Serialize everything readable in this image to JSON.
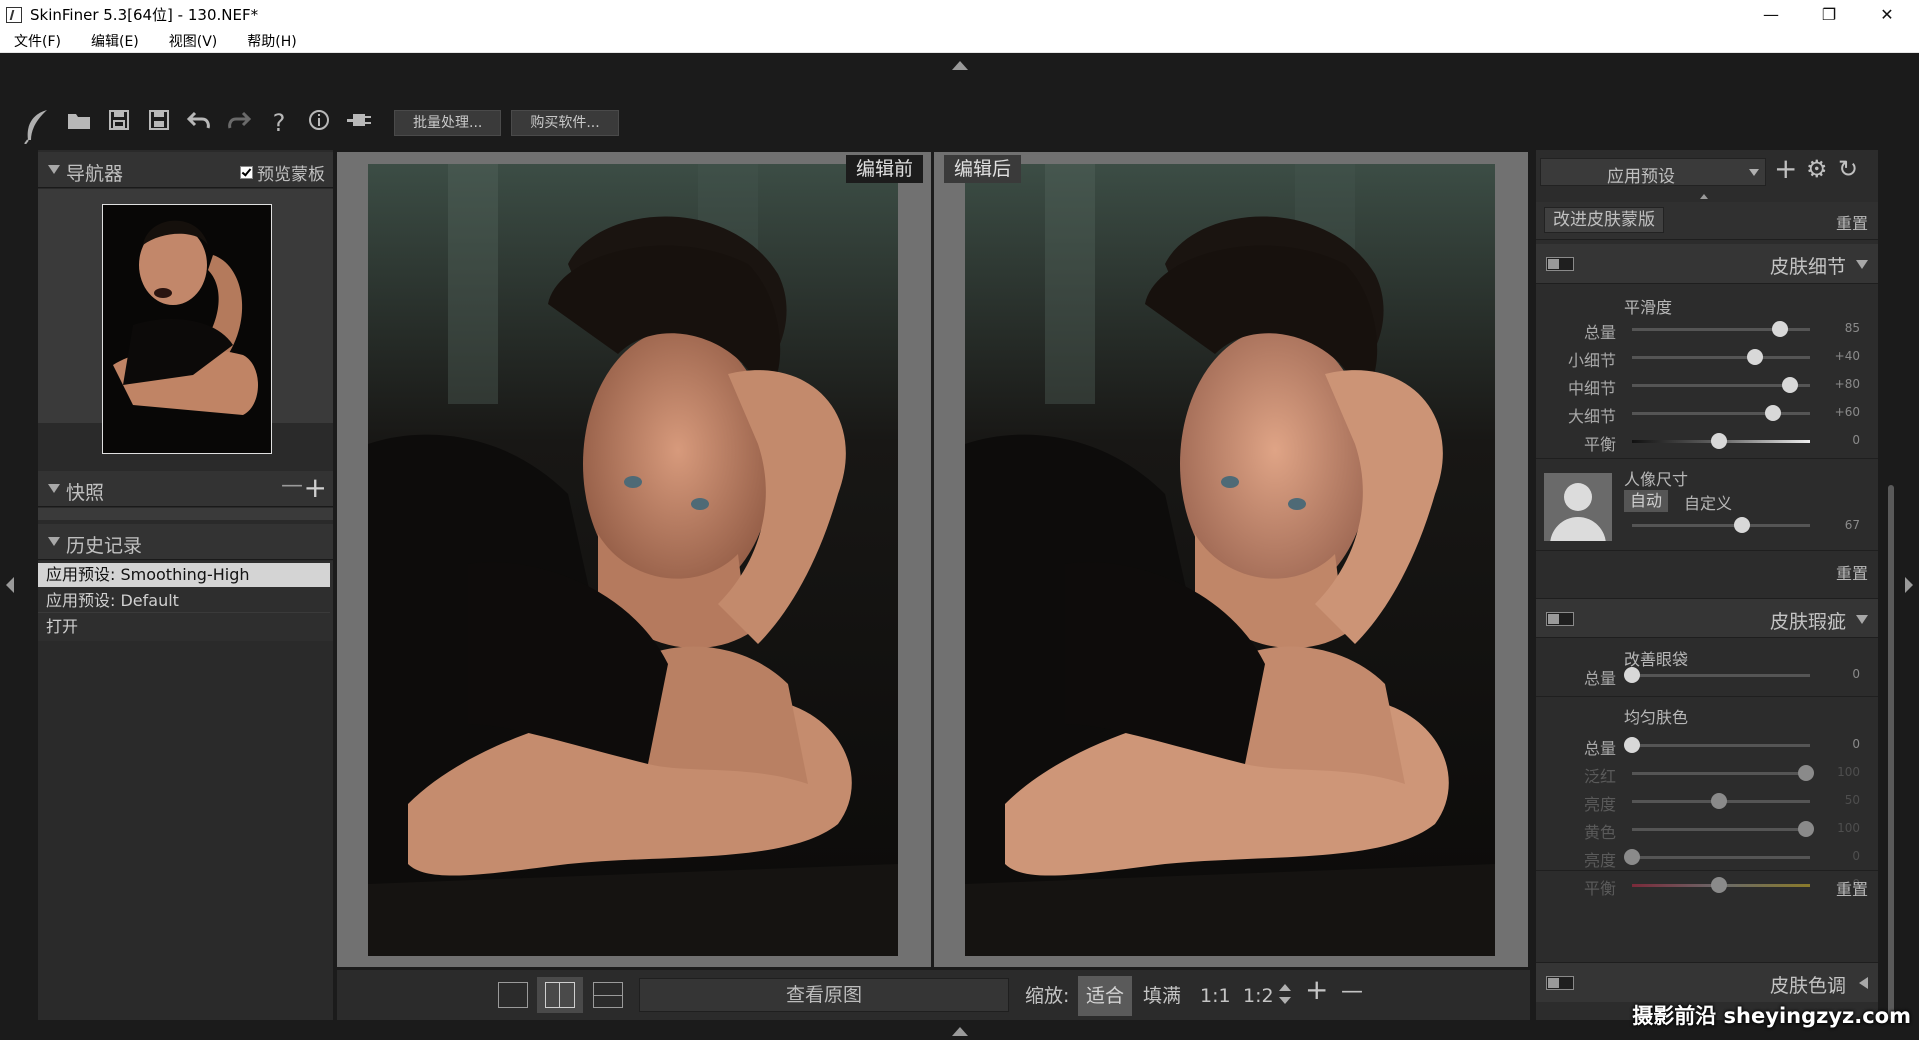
{
  "window": {
    "title": "SkinFiner 5.3[64位] - 130.NEF*",
    "minimize_glyph": "—",
    "restore_glyph": "❐",
    "close_glyph": "✕"
  },
  "menu": [
    "文件(F)",
    "编辑(E)",
    "视图(V)",
    "帮助(H)"
  ],
  "toolbar": {
    "icons": [
      "feather-logo-icon",
      "open-folder-icon",
      "save-icon",
      "save-as-icon",
      "undo-icon",
      "redo-icon",
      "help-icon",
      "info-icon",
      "plugin-icon"
    ],
    "batch_button": "批量处理...",
    "buy_button": "购买软件..."
  },
  "navigator": {
    "title": "导航器",
    "preview_mask_label": "预览蒙板",
    "preview_mask_checked": true
  },
  "snapshots": {
    "title": "快照",
    "remove_glyph": "—",
    "add_glyph": "+"
  },
  "history": {
    "title": "历史记录",
    "items": [
      {
        "label": "应用预设: Smoothing-High",
        "selected": true
      },
      {
        "label": "应用预设: Default",
        "selected": false
      },
      {
        "label": "打开",
        "selected": false
      }
    ]
  },
  "view": {
    "before_label": "编辑前",
    "after_label": "编辑后"
  },
  "bottom": {
    "view_original": "查看原图",
    "zoom_label": "缩放:",
    "zoom_options": [
      "适合",
      "填满",
      "1:1",
      "1:2"
    ],
    "zoom_selected": "适合",
    "zoom_in": "+",
    "zoom_out": "—"
  },
  "right": {
    "preset_label": "应用预设",
    "improve_mask": "改进皮肤蒙版",
    "reset": "重置",
    "skin_detail": {
      "title": "皮肤细节",
      "smooth_title": "平滑度",
      "sliders": [
        {
          "label": "总量",
          "value": "85",
          "pos": 0.83
        },
        {
          "label": "小细节",
          "value": "+40",
          "pos": 0.69
        },
        {
          "label": "中细节",
          "value": "+80",
          "pos": 0.89
        },
        {
          "label": "大细节",
          "value": "+60",
          "pos": 0.79
        },
        {
          "label": "平衡",
          "value": "0",
          "pos": 0.49
        }
      ],
      "portrait_size_title": "人像尺寸",
      "auto_label": "自动",
      "custom_label": "自定义",
      "portrait_value": "67",
      "portrait_pos": 0.62
    },
    "skin_flaws": {
      "title": "皮肤瑕疵",
      "eye_bags_title": "改善眼袋",
      "eye_bags_slider": {
        "label": "总量",
        "value": "0",
        "pos": 0.0
      },
      "even_tone_title": "均匀肤色",
      "even_sliders": [
        {
          "label": "总量",
          "value": "0",
          "pos": 0.0,
          "dim": false
        },
        {
          "label": "泛红",
          "value": "100",
          "pos": 0.98,
          "dim": true
        },
        {
          "label": "亮度",
          "value": "50",
          "pos": 0.49,
          "dim": true
        },
        {
          "label": "黄色",
          "value": "100",
          "pos": 0.98,
          "dim": true
        },
        {
          "label": "亮度",
          "value": "0",
          "pos": 0.0,
          "dim": true
        },
        {
          "label": "平衡",
          "value": "0",
          "pos": 0.49,
          "dim": true
        }
      ]
    },
    "skin_tone": {
      "title": "皮肤色调"
    }
  },
  "watermark": "摄影前沿 sheyingzyz.com"
}
